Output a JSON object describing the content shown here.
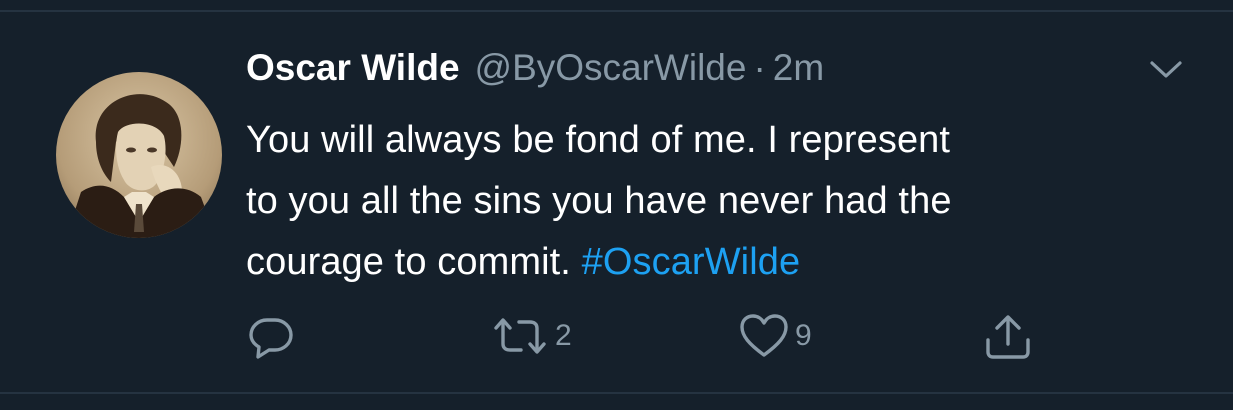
{
  "tweet": {
    "author_name": "Oscar Wilde",
    "handle": "@ByOscarWilde",
    "separator": "·",
    "time": "2m",
    "text_lines": [
      "You will always be fond of me. I represent",
      "to you all the sins you have never had the",
      "courage to commit."
    ],
    "hashtag": "#OscarWilde"
  },
  "actions": {
    "reply_icon": "speech-bubble-icon",
    "retweet_icon": "retweet-icon",
    "retweet_count": "2",
    "like_icon": "heart-icon",
    "like_count": "9",
    "share_icon": "share-upload-icon"
  },
  "colors": {
    "background": "#15202b",
    "text": "#ffffff",
    "muted": "#8899a6",
    "link": "#1da1f2",
    "divider": "#253341"
  }
}
